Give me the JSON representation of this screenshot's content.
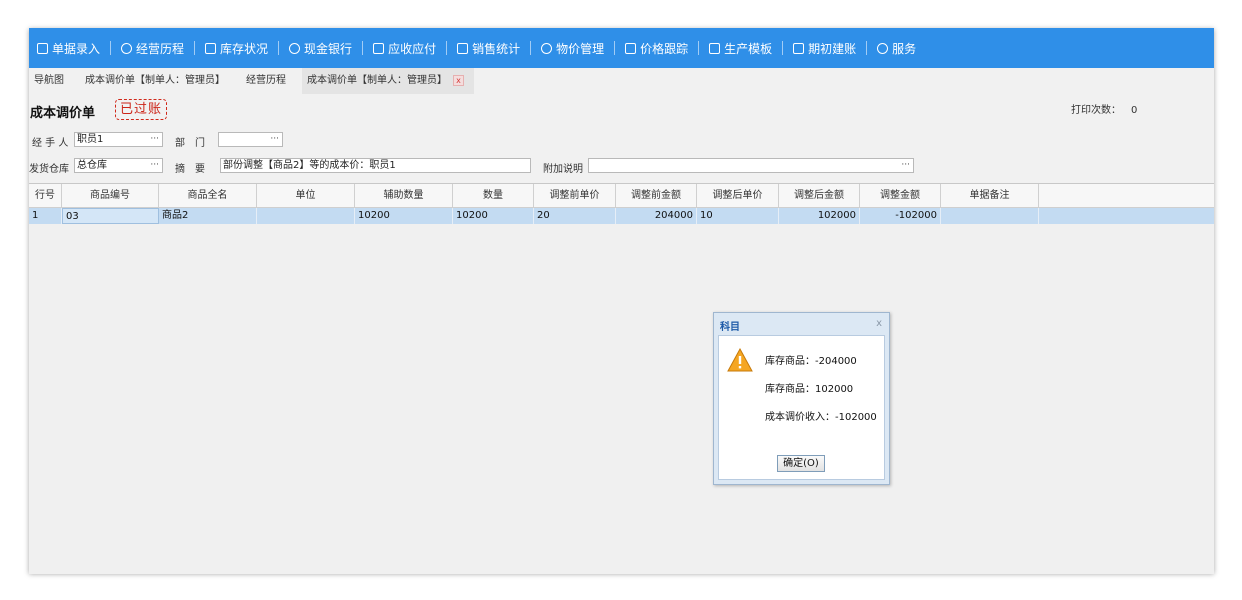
{
  "menu": {
    "items": [
      {
        "label": "单据录入",
        "icon": "edit-doc-icon"
      },
      {
        "label": "经营历程",
        "icon": "chart-circle-icon"
      },
      {
        "label": "库存状况",
        "icon": "warehouse-icon"
      },
      {
        "label": "现金银行",
        "icon": "yen-coin-icon"
      },
      {
        "label": "应收应付",
        "icon": "receivable-icon"
      },
      {
        "label": "销售统计",
        "icon": "sales-stats-icon"
      },
      {
        "label": "物价管理",
        "icon": "price-coin-icon"
      },
      {
        "label": "价格跟踪",
        "icon": "price-track-icon"
      },
      {
        "label": "生产模板",
        "icon": "production-template-icon"
      },
      {
        "label": "期初建账",
        "icon": "opening-account-icon"
      },
      {
        "label": "服务",
        "icon": "help-circle-icon"
      }
    ]
  },
  "tabs": [
    {
      "label": "导航图"
    },
    {
      "label": "成本调价单【制单人：管理员】"
    },
    {
      "label": "经营历程"
    },
    {
      "label": "成本调价单【制单人：管理员】",
      "close": "x"
    }
  ],
  "doc": {
    "title": "成本调价单",
    "stamp": "已过账",
    "print_count_label": "打印次数：",
    "print_count_value": "0"
  },
  "form": {
    "handler_label": "经 手 人",
    "handler_value": "职员1",
    "dept_label": "部　门",
    "dept_value": "",
    "warehouse_label": "发货仓库",
    "warehouse_value": "总仓库",
    "summary_label": "摘　要",
    "summary_value": "部份调整【商品2】等的成本价：职员1",
    "note_label": "附加说明",
    "note_value": "",
    "ellipsis": "···"
  },
  "grid": {
    "columns": [
      "行号",
      "商品编号",
      "商品全名",
      "单位",
      "辅助数量",
      "数量",
      "调整前单价",
      "调整前金额",
      "调整后单价",
      "调整后金额",
      "调整金额",
      "单据备注"
    ],
    "rows": [
      [
        "1",
        "03",
        "商品2",
        "",
        "10200",
        "10200",
        "20",
        "204000",
        "10",
        "102000",
        "-102000",
        ""
      ]
    ]
  },
  "dialog": {
    "title": "科目",
    "close": "x",
    "lines": [
      "库存商品：-204000",
      "库存商品：102000",
      "成本调价收入：-102000"
    ],
    "ok_label": "确定(O)",
    "icon": "warning-icon"
  },
  "colors": {
    "menubar": "#2f8fe8",
    "selected_row": "#c3dbf2",
    "stamp": "#cc2418",
    "dialog_title": "#1d5aa8"
  }
}
